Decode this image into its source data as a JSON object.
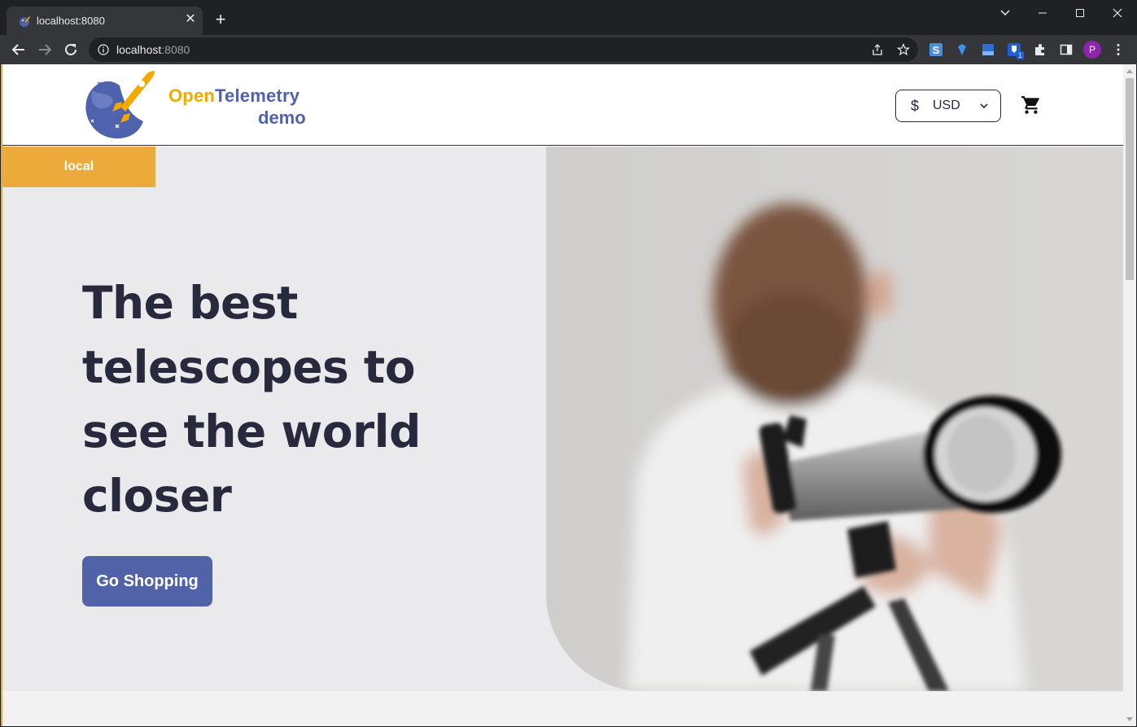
{
  "browser": {
    "tab_title": "localhost:8080",
    "url_host": "localhost",
    "url_port": ":8080",
    "profile_initial": "P",
    "extension_badge": "1"
  },
  "header": {
    "logo_open": "Open",
    "logo_telemetry": "Telemetry",
    "logo_demo": "demo",
    "currency_symbol": "$",
    "currency_code": "USD"
  },
  "hero": {
    "env_label": "local",
    "title": "The best telescopes to see the world closer",
    "cta_label": "Go Shopping"
  },
  "colors": {
    "brand_orange": "#f5a800",
    "brand_blue": "#4f62ad",
    "cta": "#5262a8",
    "badge": "#ecaa3a",
    "text_dark": "#29293e"
  }
}
